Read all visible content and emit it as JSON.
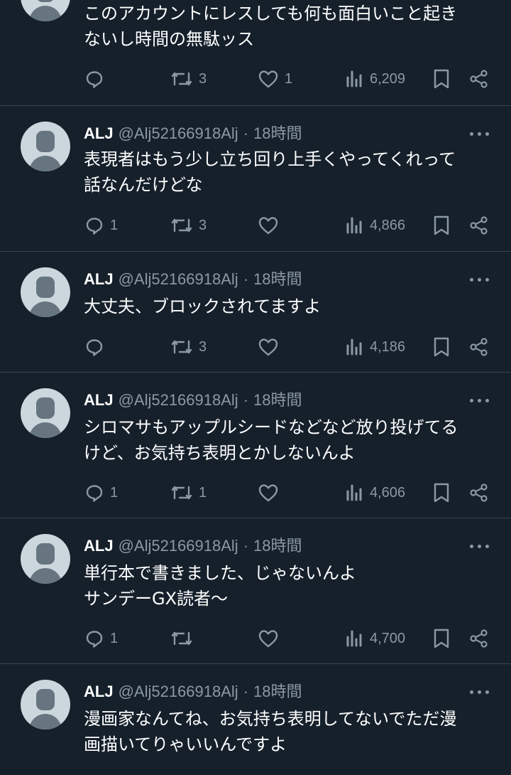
{
  "tweets": [
    {
      "show_header": false,
      "name": "",
      "handle": "",
      "separator": "",
      "time": "",
      "text": "このアカウントにレスしても何も面白いこと起き\nないし時間の無駄ッス",
      "replies": "",
      "retweets": "3",
      "likes": "1",
      "views": "6,209"
    },
    {
      "show_header": true,
      "name": "ALJ",
      "handle": "@Alj52166918Alj",
      "separator": "·",
      "time": "18時間",
      "text": "表現者はもう少し立ち回り上手くやってくれって\n話なんだけどな",
      "replies": "1",
      "retweets": "3",
      "likes": "",
      "views": "4,866"
    },
    {
      "show_header": true,
      "name": "ALJ",
      "handle": "@Alj52166918Alj",
      "separator": "·",
      "time": "18時間",
      "text": "大丈夫、ブロックされてますよ",
      "replies": "",
      "retweets": "3",
      "likes": "",
      "views": "4,186"
    },
    {
      "show_header": true,
      "name": "ALJ",
      "handle": "@Alj52166918Alj",
      "separator": "·",
      "time": "18時間",
      "text": "シロマサもアップルシードなどなど放り投げてる\nけど、お気持ち表明とかしないんよ",
      "replies": "1",
      "retweets": "1",
      "likes": "",
      "views": "4,606"
    },
    {
      "show_header": true,
      "name": "ALJ",
      "handle": "@Alj52166918Alj",
      "separator": "·",
      "time": "18時間",
      "text": "単行本で書きました、じゃないんよ\nサンデーGX読者〜",
      "replies": "1",
      "retweets": "",
      "likes": "",
      "views": "4,700"
    },
    {
      "show_header": true,
      "name": "ALJ",
      "handle": "@Alj52166918Alj",
      "separator": "·",
      "time": "18時間",
      "text": "漫画家なんてね、お気持ち表明してないでただ漫\n画描いてりゃいいんですよ",
      "replies": "",
      "retweets": "",
      "likes": "",
      "views": ""
    }
  ],
  "icons": {
    "reply": "reply-icon",
    "retweet": "retweet-icon",
    "like": "heart-icon",
    "views": "views-icon",
    "bookmark": "bookmark-icon",
    "share": "share-icon",
    "more": "more-icon"
  },
  "colors": {
    "background": "#15202b",
    "divider": "#38444d",
    "text": "#ffffff",
    "secondary_text": "#8b98a5",
    "avatar_bg": "#ccd6dd",
    "avatar_fg": "#66757f"
  }
}
